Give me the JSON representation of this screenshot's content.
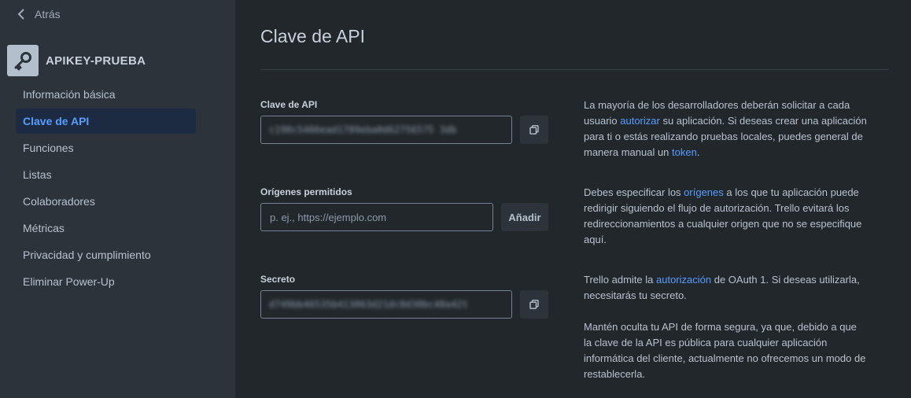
{
  "sidebar": {
    "back_label": "Atrás",
    "app_name": "APIKEY-PRUEBA",
    "app_icon": "key-icon",
    "items": [
      {
        "label": "Información básica",
        "active": false
      },
      {
        "label": "Clave de API",
        "active": true
      },
      {
        "label": "Funciones",
        "active": false
      },
      {
        "label": "Listas",
        "active": false
      },
      {
        "label": "Colaboradores",
        "active": false
      },
      {
        "label": "Métricas",
        "active": false
      },
      {
        "label": "Privacidad y cumplimiento",
        "active": false
      },
      {
        "label": "Eliminar Power-Up",
        "active": false
      }
    ]
  },
  "main": {
    "title": "Clave de API",
    "api_key": {
      "label": "Clave de API",
      "value": "c190c5466ead1789eba0d62756575 3db",
      "desc_pre": "La mayoría de los desarrolladores deberán solicitar a cada usuario ",
      "desc_link1": "autorizar",
      "desc_mid": " su aplicación. Si deseas crear una aplicación para ti o estás realizando pruebas locales, puedes general de manera manual un ",
      "desc_link2": "token",
      "desc_post": "."
    },
    "origins": {
      "label": "Orígenes permitidos",
      "placeholder": "p. ej., https://ejemplo.com",
      "add_label": "Añadir",
      "desc_pre": "Debes especificar los ",
      "desc_link": "orígenes",
      "desc_post": " a los que tu aplicación puede redirigir siguiendo el flujo de autorización. Trello evitará los redireccionamientos a cualquier origen que no se especifique aquí."
    },
    "secret": {
      "label": "Secreto",
      "value": "d749bb46535b413063d21dc0d30bc48a42t",
      "desc_pre": "Trello admite la ",
      "desc_link": "autorización",
      "desc_post": " de OAuth 1. Si deseas utilizarla, necesitarás tu secreto.",
      "note": "Mantén oculta tu API de forma segura, ya que, debido a que la clave de la API es pública para cualquier aplicación informática del cliente, actualmente no ofrecemos un modo de restablecerla."
    }
  },
  "colors": {
    "background": "#22272b",
    "sidebar": "#2c333a",
    "accent": "#579dff"
  }
}
